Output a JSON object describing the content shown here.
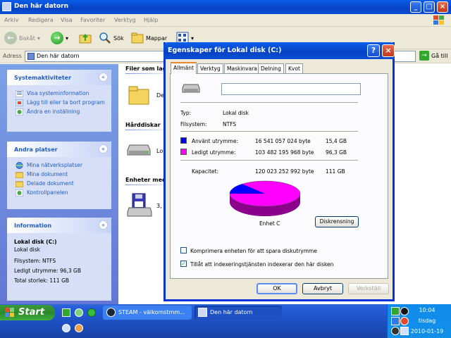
{
  "window": {
    "title": "Den här datorn",
    "menu": [
      "Arkiv",
      "Redigera",
      "Visa",
      "Favoriter",
      "Verktyg",
      "Hjälp"
    ],
    "toolbar": {
      "back": "Bakåt",
      "search": "Sök",
      "folders": "Mappar"
    },
    "address_label": "Adress",
    "address_value": "Den här datorn",
    "go_label": "Gå till"
  },
  "taskpane": {
    "system": {
      "title": "Systemaktiviteter",
      "links": [
        "Visa systeminformation",
        "Lägg till eller ta bort program",
        "Ändra en inställning"
      ]
    },
    "places": {
      "title": "Andra platser",
      "links": [
        "Mina nätverksplatser",
        "Mina dokument",
        "Delade dokument",
        "Kontrollpanelen"
      ]
    },
    "info": {
      "title": "Information",
      "name": "Lokal disk (C:)",
      "type": "Lokal disk",
      "filesystem": "Filsystem: NTFS",
      "free": "Ledigt utrymme: 96,3 GB",
      "total": "Total storlek: 111 GB"
    }
  },
  "main": {
    "group_files": "Filer som lagr...",
    "folder_label": "De",
    "group_drives": "Hårddiskar",
    "drive_label": "Lo",
    "group_removable": "Enheter med",
    "floppy_label": "3,"
  },
  "dialog": {
    "title": "Egenskaper för Lokal disk (C:)",
    "tabs": [
      "Allmänt",
      "Verktyg",
      "Maskinvara",
      "Delning",
      "Kvot"
    ],
    "name_value": "",
    "type_label": "Typ:",
    "type_value": "Lokal disk",
    "fs_label": "Filsystem:",
    "fs_value": "NTFS",
    "used_label": "Använt utrymme:",
    "used_bytes": "16 541 057 024 byte",
    "used_gb": "15,4 GB",
    "free_label": "Ledigt utrymme:",
    "free_bytes": "103 482 195 968 byte",
    "free_gb": "96,3 GB",
    "cap_label": "Kapacitet:",
    "cap_bytes": "120 023 252 992 byte",
    "cap_gb": "111 GB",
    "drive_label": "Enhet C",
    "cleanup_button": "Diskrensning",
    "compress_label": "Komprimera enheten för att spara diskutrymme",
    "index_label": "Tillåt att indexeringstjänsten indexerar den här disken",
    "ok": "OK",
    "cancel": "Avbryt",
    "apply": "Verkställ",
    "used_fraction": 0.138,
    "colors": {
      "used": "#0000ff",
      "free": "#ff00ff"
    }
  },
  "taskbar": {
    "start": "Start",
    "tasks": [
      "STEAM - välkomstmm...",
      "Den här datorn"
    ],
    "time": "10:04",
    "day": "tisdag",
    "date": "2010-01-19"
  }
}
